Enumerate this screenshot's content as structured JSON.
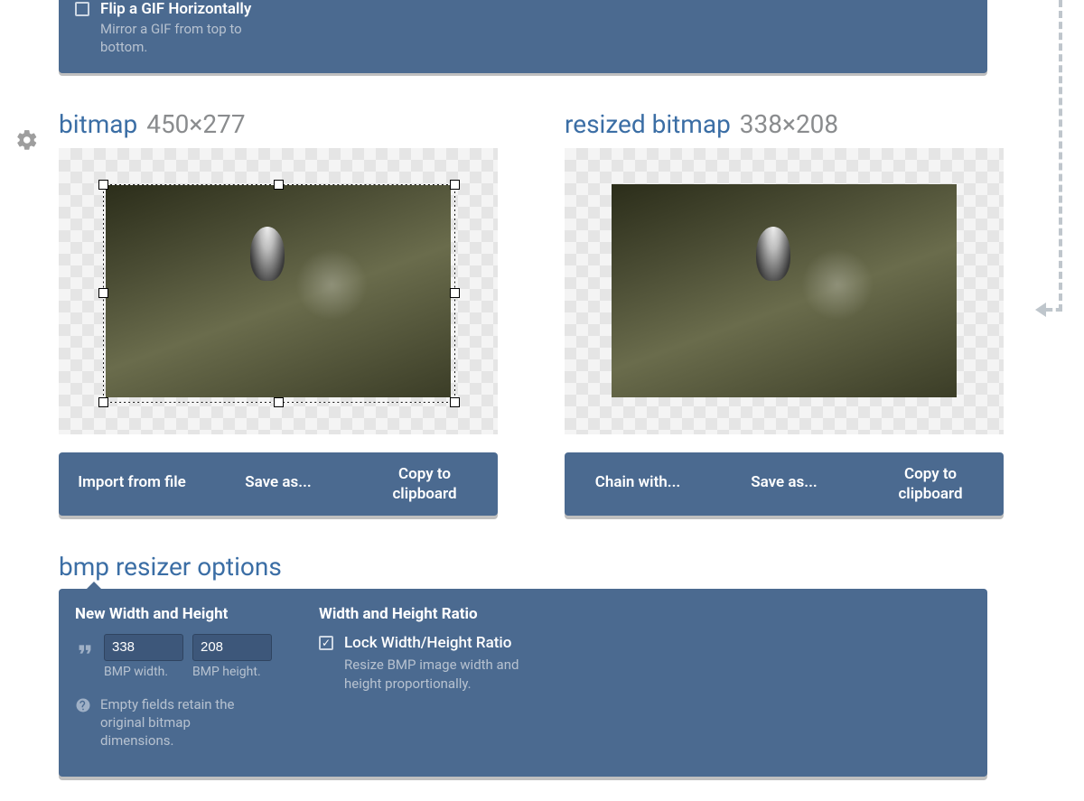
{
  "top_option": {
    "title": "Flip a GIF Horizontally",
    "desc": "Mirror a GIF from top to bottom.",
    "checked": false
  },
  "left": {
    "head_blue": "bitmap",
    "head_grey": "450×277",
    "actions": {
      "import": "Import from file",
      "save": "Save as...",
      "copy_l1": "Copy to",
      "copy_l2": "clipboard"
    }
  },
  "right": {
    "head_blue": "resized bitmap",
    "head_grey": "338×208",
    "actions": {
      "chain": "Chain with...",
      "save": "Save as...",
      "copy_l1": "Copy to",
      "copy_l2": "clipboard"
    }
  },
  "options": {
    "heading": "bmp resizer options",
    "col_a_title": "New Width and Height",
    "width_value": "338",
    "height_value": "208",
    "width_label": "BMP width.",
    "height_label": "BMP height.",
    "info": "Empty fields retain the original bitmap dimensions.",
    "col_b_title": "Width and Height Ratio",
    "lock_label": "Lock Width/Height Ratio",
    "lock_desc": "Resize BMP image width and height proportionally.",
    "lock_checked": true
  }
}
